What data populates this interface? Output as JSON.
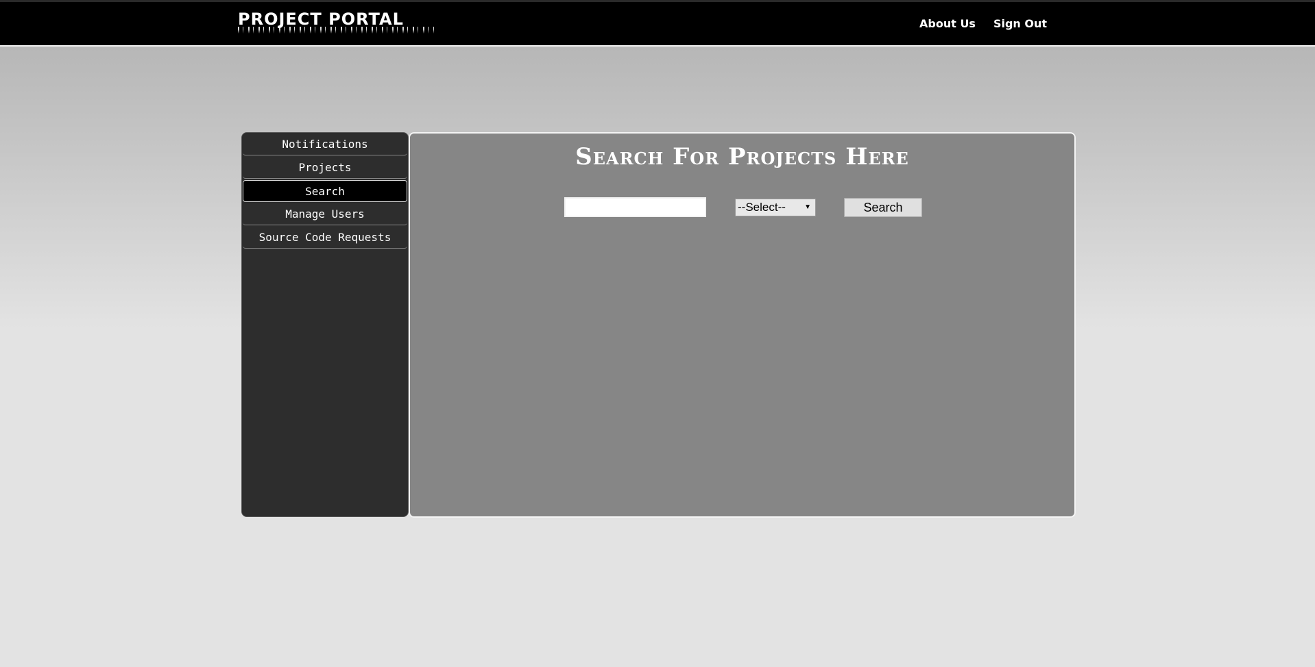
{
  "header": {
    "logo": "PROJECT PORTAL",
    "nav": [
      {
        "label": "About Us"
      },
      {
        "label": "Sign Out"
      }
    ]
  },
  "sidebar": {
    "items": [
      {
        "label": "Notifications"
      },
      {
        "label": "Projects"
      },
      {
        "label": "Search",
        "active": true
      },
      {
        "label": "Manage Users"
      },
      {
        "label": "Source Code Requests"
      }
    ]
  },
  "main": {
    "title": "Search For Projects Here",
    "search_value": "",
    "select_value": "--Select--",
    "search_button": "Search"
  }
}
